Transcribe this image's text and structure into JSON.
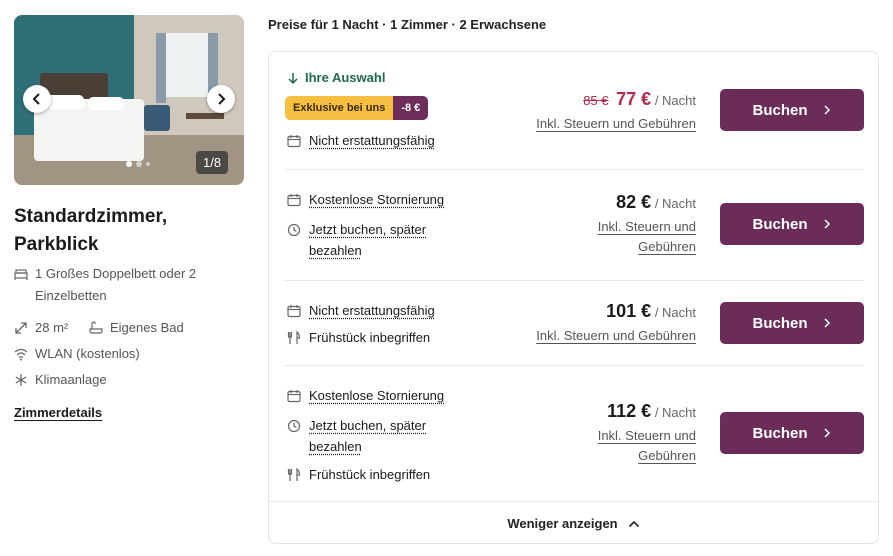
{
  "gallery": {
    "counter": "1/8",
    "prev_icon": "chevron-left-icon",
    "next_icon": "chevron-right-icon"
  },
  "room": {
    "title": "Standardzimmer, Parkblick",
    "features": [
      {
        "icon": "bed-icon",
        "text": "1 Großes Doppelbett oder 2 Einzelbetten"
      },
      {
        "icon": "area-icon",
        "text": "28 m²"
      },
      {
        "icon": "bath-icon",
        "text": "Eigenes Bad"
      },
      {
        "icon": "wifi-icon",
        "text": "WLAN (kostenlos)"
      },
      {
        "icon": "snowflake-icon",
        "text": "Klimaanlage"
      }
    ],
    "details_link": "Zimmerdetails"
  },
  "prices": {
    "heading": "Preise für 1 Nacht · 1 Zimmer · 2 Erwachsene",
    "your_choice": "Ihre Auswahl",
    "badge_label": "Exklusive bei uns",
    "badge_discount": "-8 €",
    "per_night": "/ Nacht",
    "book_label": "Buchen",
    "show_less": "Weniger anzeigen",
    "options": [
      {
        "lines": [
          "Nicht erstattungsfähig"
        ],
        "old_price": "85 €",
        "price": "77 €",
        "tax": "Inkl. Steuern und Gebühren"
      },
      {
        "lines": [
          "Kostenlose Stornierung",
          "Jetzt buchen, später bezahlen"
        ],
        "price": "82 €",
        "tax": "Inkl. Steuern und Gebühren"
      },
      {
        "lines": [
          "Nicht erstattungsfähig",
          "Frühstück inbegriffen"
        ],
        "price": "101 €",
        "tax": "Inkl. Steuern und Gebühren"
      },
      {
        "lines": [
          "Kostenlose Stornierung",
          "Jetzt buchen, später bezahlen",
          "Frühstück inbegriffen"
        ],
        "price": "112 €",
        "tax": "Inkl. Steuern und Gebühren"
      }
    ]
  },
  "colors": {
    "book_button": "#6b2c5a",
    "sale_price": "#b5294a",
    "your_choice": "#1e6b52",
    "badge_yellow": "#f5c042"
  }
}
